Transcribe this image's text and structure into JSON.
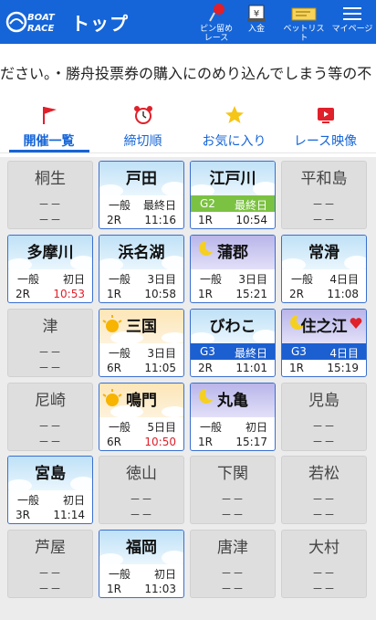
{
  "header": {
    "title": "トップ",
    "logo_line1": "BOAT",
    "logo_line2": "RACE",
    "buttons": [
      {
        "label": "ピン留め\nレース",
        "icon": "pin-icon"
      },
      {
        "label": "入金",
        "icon": "deposit-icon"
      },
      {
        "label": "ベットリスト",
        "icon": "ticket-icon"
      },
      {
        "label": "マイページ",
        "icon": "menu-icon"
      }
    ]
  },
  "marquee": {
    "text": "ださい。・勝舟投票券の購入にのめり込んでしまう等の不"
  },
  "tabs": [
    {
      "label": "開催一覧",
      "icon": "flag-icon",
      "active": true
    },
    {
      "label": "締切順",
      "icon": "alarm-clock-icon",
      "active": false
    },
    {
      "label": "お気に入り",
      "icon": "star-icon",
      "active": false
    },
    {
      "label": "レース映像",
      "icon": "video-icon",
      "active": false
    }
  ],
  "venues": [
    {
      "name": "桐生",
      "active": false,
      "dash1": "－－",
      "dash2": "－－"
    },
    {
      "name": "戸田",
      "active": true,
      "bg": "sky",
      "grade": "一般",
      "day": "最終日",
      "race": "2R",
      "time": "11:16",
      "time_red": false
    },
    {
      "name": "江戸川",
      "active": true,
      "bg": "sky",
      "grade": "G2",
      "day": "最終日",
      "badge_color": "#7cc242",
      "race": "1R",
      "time": "10:54",
      "time_red": false
    },
    {
      "name": "平和島",
      "active": false,
      "dash1": "－－",
      "dash2": "－－"
    },
    {
      "name": "多摩川",
      "active": true,
      "bg": "sky",
      "grade": "一般",
      "day": "初日",
      "race": "2R",
      "time": "10:53",
      "time_red": true
    },
    {
      "name": "浜名湖",
      "active": true,
      "bg": "sky",
      "grade": "一般",
      "day": "3日目",
      "race": "1R",
      "time": "10:58",
      "time_red": false
    },
    {
      "name": "蒲郡",
      "active": true,
      "bg": "night",
      "grade": "一般",
      "day": "3日目",
      "race": "1R",
      "time": "15:21",
      "time_red": false
    },
    {
      "name": "常滑",
      "active": true,
      "bg": "sky",
      "grade": "一般",
      "day": "4日目",
      "race": "2R",
      "time": "11:08",
      "time_red": false
    },
    {
      "name": "津",
      "active": false,
      "dash1": "－－",
      "dash2": "－－"
    },
    {
      "name": "三国",
      "active": true,
      "bg": "sunset",
      "grade": "一般",
      "day": "3日目",
      "race": "6R",
      "time": "11:05",
      "time_red": false
    },
    {
      "name": "びわこ",
      "active": true,
      "bg": "sky",
      "grade": "G3",
      "day": "最終日",
      "badge_color": "#1c5fd0",
      "race": "2R",
      "time": "11:01",
      "time_red": false
    },
    {
      "name": "住之江",
      "active": true,
      "bg": "night",
      "grade": "G3",
      "day": "4日目",
      "badge_color": "#1c5fd0",
      "race": "1R",
      "time": "15:19",
      "time_red": false,
      "favorite": true
    },
    {
      "name": "尼崎",
      "active": false,
      "dash1": "－－",
      "dash2": "－－"
    },
    {
      "name": "鳴門",
      "active": true,
      "bg": "sunset",
      "grade": "一般",
      "day": "5日目",
      "race": "6R",
      "time": "10:50",
      "time_red": true
    },
    {
      "name": "丸亀",
      "active": true,
      "bg": "night",
      "grade": "一般",
      "day": "初日",
      "race": "1R",
      "time": "15:17",
      "time_red": false
    },
    {
      "name": "児島",
      "active": false,
      "dash1": "－－",
      "dash2": "－－"
    },
    {
      "name": "宮島",
      "active": true,
      "bg": "sky",
      "grade": "一般",
      "day": "初日",
      "race": "3R",
      "time": "11:14",
      "time_red": false
    },
    {
      "name": "徳山",
      "active": false,
      "dash1": "－－",
      "dash2": "－－"
    },
    {
      "name": "下関",
      "active": false,
      "dash1": "－－",
      "dash2": "－－"
    },
    {
      "name": "若松",
      "active": false,
      "dash1": "－－",
      "dash2": "－－"
    },
    {
      "name": "芦屋",
      "active": false,
      "dash1": "－－",
      "dash2": "－－"
    },
    {
      "name": "福岡",
      "active": true,
      "bg": "sky",
      "grade": "一般",
      "day": "初日",
      "race": "1R",
      "time": "11:03",
      "time_red": false
    },
    {
      "name": "唐津",
      "active": false,
      "dash1": "－－",
      "dash2": "－－"
    },
    {
      "name": "大村",
      "active": false,
      "dash1": "－－",
      "dash2": "－－"
    }
  ],
  "colors": {
    "primary": "#1565d8",
    "red": "#e0202a",
    "g2": "#7cc242",
    "g3": "#1c5fd0"
  }
}
